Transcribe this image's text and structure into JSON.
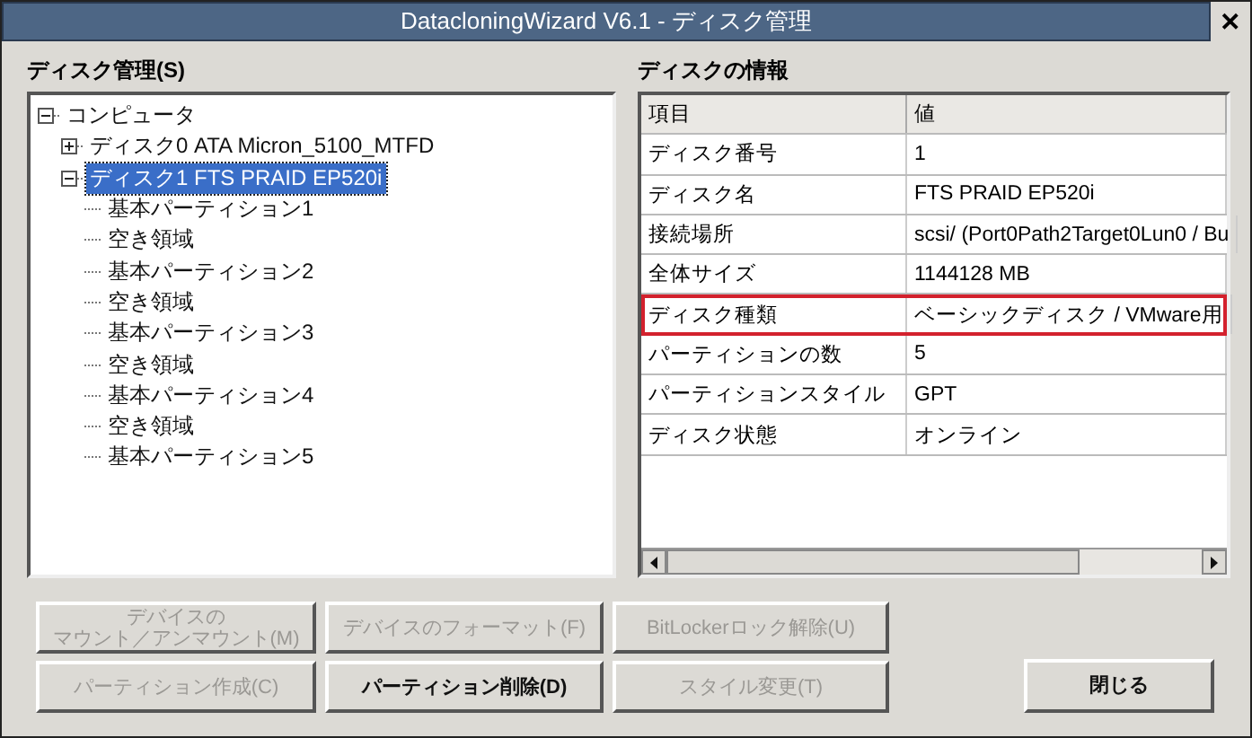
{
  "window": {
    "title": "DatacloningWizard V6.1 - ディスク管理",
    "close": "✕"
  },
  "tree_panel": {
    "label": "ディスク管理(S)",
    "items": [
      {
        "label": "コンピュータ",
        "expanded": true,
        "selected": false,
        "children": [
          {
            "label": "ディスク0 ATA Micron_5100_MTFD",
            "expanded": false,
            "selected": false
          },
          {
            "label": "ディスク1 FTS PRAID EP520i",
            "expanded": true,
            "selected": true,
            "children": [
              {
                "label": "基本パーティション1",
                "selected": false
              },
              {
                "label": "空き領域",
                "selected": false
              },
              {
                "label": "基本パーティション2",
                "selected": false
              },
              {
                "label": "空き領域",
                "selected": false
              },
              {
                "label": "基本パーティション3",
                "selected": false
              },
              {
                "label": "空き領域",
                "selected": false
              },
              {
                "label": "基本パーティション4",
                "selected": false
              },
              {
                "label": "空き領域",
                "selected": false
              },
              {
                "label": "基本パーティション5",
                "selected": false
              }
            ]
          }
        ]
      }
    ]
  },
  "info_panel": {
    "label": "ディスクの情報",
    "columns": [
      "項目",
      "値"
    ],
    "rows": [
      {
        "item": "ディスク番号",
        "value": "1",
        "highlighted": false
      },
      {
        "item": "ディスク名",
        "value": "FTS PRAID EP520i",
        "highlighted": false
      },
      {
        "item": "接続場所",
        "value": "scsi/ (Port0Path2Target0Lun0 / Bu",
        "highlighted": false
      },
      {
        "item": "全体サイズ",
        "value": "1144128 MB",
        "highlighted": false
      },
      {
        "item": "ディスク種類",
        "value": "ベーシックディスク / VMware用",
        "highlighted": true
      },
      {
        "item": "パーティションの数",
        "value": "5",
        "highlighted": false
      },
      {
        "item": "パーティションスタイル",
        "value": "GPT",
        "highlighted": false
      },
      {
        "item": "ディスク状態",
        "value": "オンライン",
        "highlighted": false
      }
    ]
  },
  "buttons": [
    {
      "lines": [
        "デバイスの",
        "マウント／アンマウント(M)"
      ],
      "disabled": true
    },
    {
      "lines": [
        "デバイスのフォーマット(F)"
      ],
      "disabled": true
    },
    {
      "lines": [
        "BitLockerロック解除(U)"
      ],
      "disabled": true
    },
    {
      "lines": [
        "パーティション作成(C)"
      ],
      "disabled": true
    },
    {
      "lines": [
        "パーティション削除(D)"
      ],
      "disabled": false
    },
    {
      "lines": [
        "スタイル変更(T)"
      ],
      "disabled": true
    }
  ],
  "close_button": {
    "label": "閉じる",
    "disabled": false
  }
}
